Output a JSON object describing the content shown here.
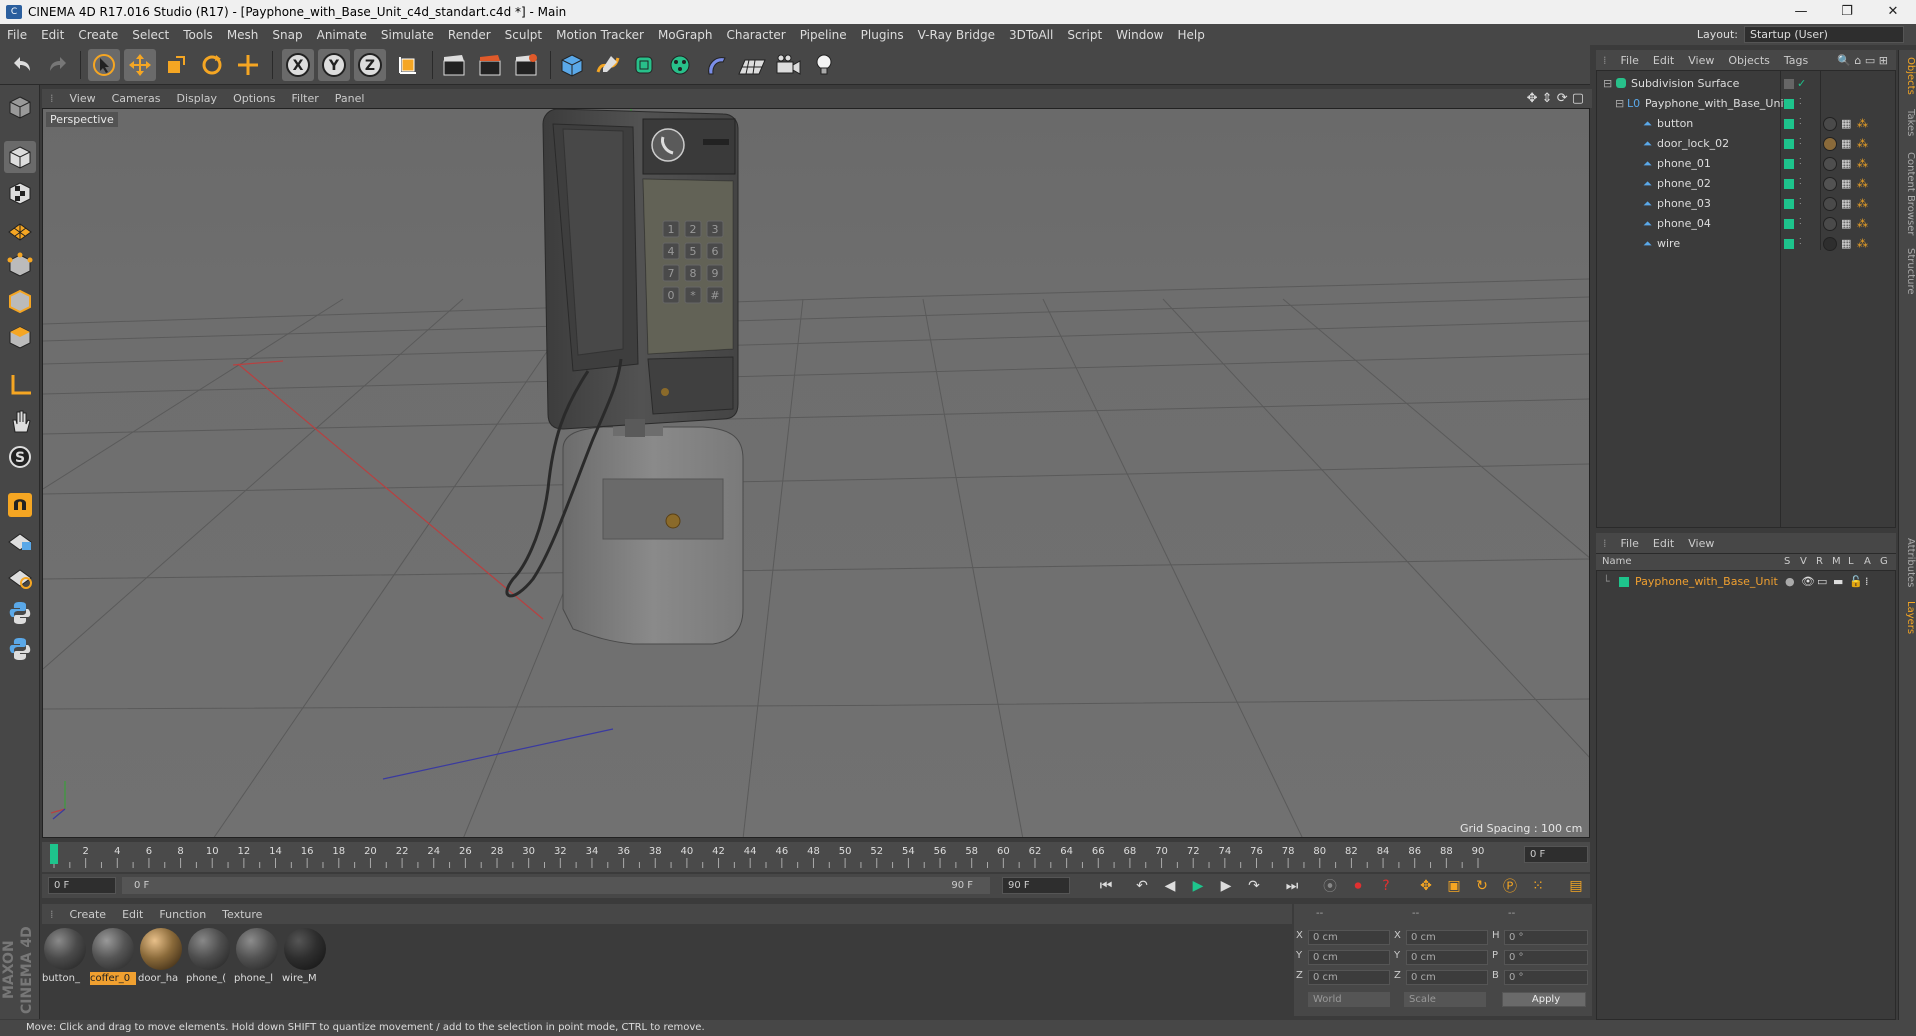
{
  "window": {
    "title": "CINEMA 4D R17.016 Studio (R17) - [Payphone_with_Base_Unit_c4d_standart.c4d *] - Main",
    "controls": [
      "—",
      "❐",
      "✕"
    ]
  },
  "menubar": {
    "items": [
      "File",
      "Edit",
      "Create",
      "Select",
      "Tools",
      "Mesh",
      "Snap",
      "Animate",
      "Simulate",
      "Render",
      "Sculpt",
      "Motion Tracker",
      "MoGraph",
      "Character",
      "Pipeline",
      "Plugins",
      "V-Ray Bridge",
      "3DToAll",
      "Script",
      "Window",
      "Help"
    ],
    "layout_label": "Layout:",
    "layout_value": "Startup (User)"
  },
  "toolbar": {
    "axis_x": "X",
    "axis_y": "Y",
    "axis_z": "Z"
  },
  "viewport": {
    "menu": [
      "View",
      "Cameras",
      "Display",
      "Options",
      "Filter",
      "Panel"
    ],
    "camera_label": "Perspective",
    "grid_spacing": "Grid Spacing : 100 cm"
  },
  "timeline": {
    "ticks": [
      "0",
      "2",
      "4",
      "6",
      "8",
      "10",
      "12",
      "14",
      "16",
      "18",
      "20",
      "22",
      "24",
      "26",
      "28",
      "30",
      "32",
      "34",
      "36",
      "38",
      "40",
      "42",
      "44",
      "46",
      "48",
      "50",
      "52",
      "54",
      "56",
      "58",
      "60",
      "62",
      "64",
      "66",
      "68",
      "70",
      "72",
      "74",
      "76",
      "78",
      "80",
      "82",
      "84",
      "86",
      "88",
      "90"
    ],
    "current_frame": "0 F",
    "start_field": "0 F",
    "range_start": "0 F",
    "range_end": "90 F",
    "end_field": "90 F"
  },
  "materials": {
    "menu": [
      "Create",
      "Edit",
      "Function",
      "Texture"
    ],
    "items": [
      {
        "label": "button_",
        "color": "#4a4a4a"
      },
      {
        "label": "coffer_0",
        "color": "#555555"
      },
      {
        "label": "door_ha",
        "color": "#8a6a3a"
      },
      {
        "label": "phone_(",
        "color": "#4e4e4e"
      },
      {
        "label": "phone_l",
        "color": "#525252"
      },
      {
        "label": "wire_M",
        "color": "#2e2e2e"
      }
    ]
  },
  "coordinates": {
    "header": [
      "--",
      "--",
      "--"
    ],
    "rows": [
      {
        "a": "X",
        "av": "0 cm",
        "b": "X",
        "bv": "0 cm",
        "c": "H",
        "cv": "0 °"
      },
      {
        "a": "Y",
        "av": "0 cm",
        "b": "Y",
        "bv": "0 cm",
        "c": "P",
        "cv": "0 °"
      },
      {
        "a": "Z",
        "av": "0 cm",
        "b": "Z",
        "bv": "0 cm",
        "c": "B",
        "cv": "0 °"
      }
    ],
    "space": "World",
    "mode": "Scale",
    "apply": "Apply"
  },
  "objects": {
    "menu": [
      "File",
      "Edit",
      "View",
      "Objects",
      "Tags"
    ],
    "items": [
      {
        "name": "Subdivision Surface",
        "indent": 0
      },
      {
        "name": "Payphone_with_Base_Unit",
        "indent": 1
      },
      {
        "name": "button",
        "indent": 2
      },
      {
        "name": "door_lock_02",
        "indent": 2
      },
      {
        "name": "phone_01",
        "indent": 2
      },
      {
        "name": "phone_02",
        "indent": 2
      },
      {
        "name": "phone_03",
        "indent": 2
      },
      {
        "name": "phone_04",
        "indent": 2
      },
      {
        "name": "wire",
        "indent": 2
      }
    ]
  },
  "layers": {
    "menu": [
      "File",
      "Edit",
      "View"
    ],
    "header_name": "Name",
    "header_cols": [
      "S",
      "V",
      "R",
      "M",
      "L",
      "A",
      "G"
    ],
    "items": [
      {
        "name": "Payphone_with_Base_Unit"
      }
    ]
  },
  "sidetabs": [
    "Objects",
    "Takes",
    "Content Browser",
    "Structure",
    "Attributes",
    "Layers"
  ],
  "status": "Move: Click and drag to move elements. Hold down SHIFT to quantize movement / add to the selection in point mode, CTRL to remove.",
  "brand": "MAXON CINEMA 4D",
  "colors": {
    "accent": "#f5a623",
    "layer": "#1ec48c",
    "selected_text": "#f0a030"
  }
}
